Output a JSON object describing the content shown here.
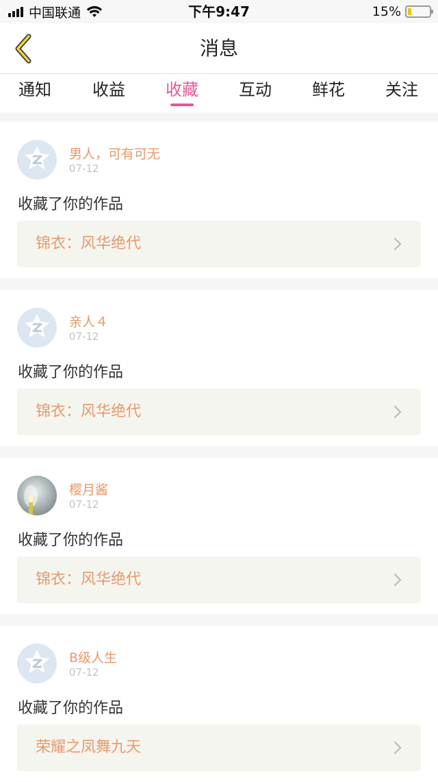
{
  "status_bar": {
    "carrier": "中国联通",
    "time": "下午9:47",
    "battery": "15%",
    "battery_level": 0.15
  },
  "header": {
    "title": "消息"
  },
  "tabs": [
    {
      "label": "通知",
      "active": false
    },
    {
      "label": "收益",
      "active": false
    },
    {
      "label": "收藏",
      "active": true
    },
    {
      "label": "互动",
      "active": false
    },
    {
      "label": "鲜花",
      "active": false
    },
    {
      "label": "关注",
      "active": false
    }
  ],
  "messages": [
    {
      "user": "男人，可有可无",
      "date": "07-12",
      "action": "收藏了你的作品",
      "work": "锦衣：风华绝代"
    },
    {
      "user": "亲人４",
      "date": "07-12",
      "action": "收藏了你的作品",
      "work": "锦衣：风华绝代"
    },
    {
      "user": "樱月酱",
      "date": "07-12",
      "action": "收藏了你的作品",
      "work": "锦衣：风华绝代"
    },
    {
      "user": "B级人生",
      "date": "07-12",
      "action": "收藏了你的作品",
      "work": "荣耀之凤舞九天"
    }
  ],
  "colors": {
    "accent": "#e8559a",
    "name": "#e8996a",
    "work_bg": "#f5f5ef"
  }
}
